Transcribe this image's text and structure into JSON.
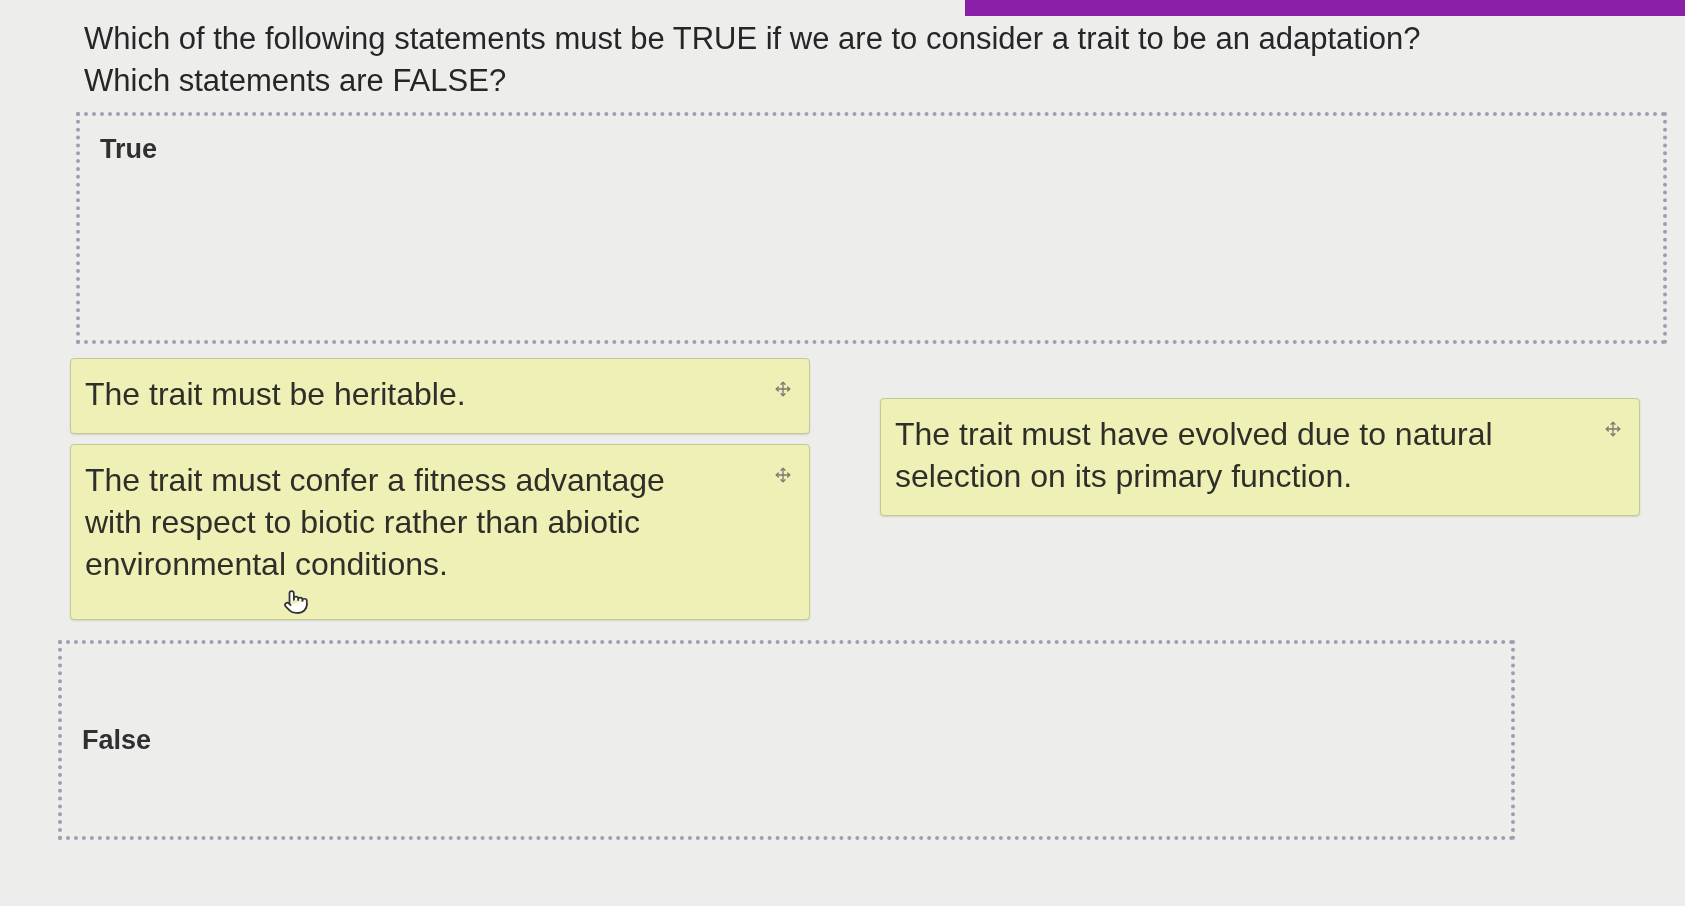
{
  "question": {
    "lines": [
      "Which of the following statements must be TRUE if we are to consider a trait to be an adaptation?",
      "Which statements are FALSE?"
    ]
  },
  "true_zone": {
    "label": "True"
  },
  "card_columns": [
    [
      {
        "text": "The trait must be heritable."
      },
      {
        "text": "The trait must confer a fitness advantage with respect to biotic rather than abiotic environmental conditions.",
        "pointer": true
      }
    ],
    [
      {
        "text": "The trait must have evolved due to natural selection on its primary function."
      }
    ]
  ],
  "false_zone": {
    "label": "False"
  }
}
